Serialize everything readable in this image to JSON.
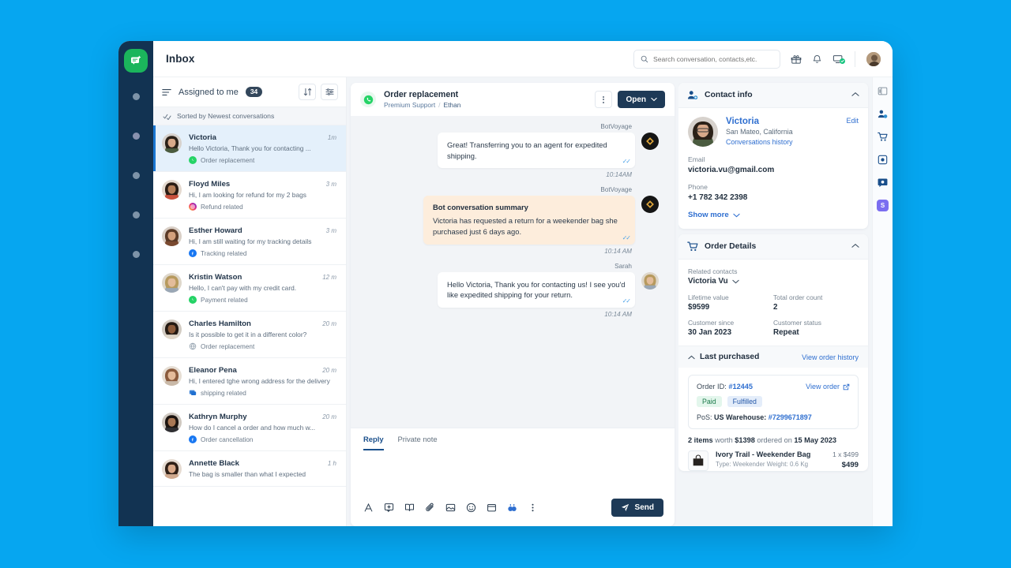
{
  "topbar": {
    "title": "Inbox",
    "search_placeholder": "Search conversation, contacts,etc.",
    "icons": [
      "gift-icon",
      "bell-icon",
      "screen-check-icon",
      "user-avatar"
    ]
  },
  "conversation_list": {
    "header_label": "Assigned to me",
    "header_count": "34",
    "sort_button": "sort-icon",
    "filter_button": "filter-icon",
    "sorted_label": "Sorted by Newest conversations",
    "items": [
      {
        "name": "Victoria",
        "time": "1m",
        "message": "Hello Victoria, Thank you for contacting ...",
        "tag": "Order replacement",
        "tag_channel": "whatsapp",
        "active": true
      },
      {
        "name": "Floyd Miles",
        "time": "3 m",
        "message": "Hi, I am looking for refund for my 2 bags",
        "tag": "Refund related",
        "tag_channel": "instagram",
        "active": false
      },
      {
        "name": "Esther Howard",
        "time": "3 m",
        "message": "Hi, I am still waiting for my tracking details",
        "tag": "Tracking related",
        "tag_channel": "facebook",
        "active": false
      },
      {
        "name": "Kristin Watson",
        "time": "12 m",
        "message": "Hello, I can't pay with my credit card.",
        "tag": "Payment related",
        "tag_channel": "whatsapp",
        "active": false
      },
      {
        "name": "Charles Hamilton",
        "time": "20 m",
        "message": "Is it possible to get it in a different color?",
        "tag": "Order replacement",
        "tag_channel": "web",
        "active": false
      },
      {
        "name": "Eleanor Pena",
        "time": "20 m",
        "message": "Hi, I entered tghe wrong address for the delivery",
        "tag": "shipping related",
        "tag_channel": "chat",
        "active": false
      },
      {
        "name": "Kathryn Murphy",
        "time": "20 m",
        "message": "How do I cancel a order and how much w...",
        "tag": "Order cancellation",
        "tag_channel": "facebook",
        "active": false
      },
      {
        "name": "Annette Black",
        "time": "1 h",
        "message": "The bag is smaller than what I expected",
        "tag": "",
        "tag_channel": "",
        "active": false
      }
    ]
  },
  "conversation": {
    "title": "Order replacement",
    "sub_team": "Premium Support",
    "sub_agent": "Ethan",
    "status_button": "Open",
    "messages": [
      {
        "sender": "BotVoyage",
        "title": "",
        "text": "Great! Transferring you to an agent for expedited shipping.",
        "time": "10:14AM",
        "style": "white",
        "avatar": "bot"
      },
      {
        "sender": "BotVoyage",
        "title": "Bot conversation summary",
        "text": "Victoria has requested a return for a weekender bag she purchased just 6 days ago.",
        "time": "10:14 AM",
        "style": "peach",
        "avatar": "bot"
      },
      {
        "sender": "Sarah",
        "title": "",
        "text": "Hello Victoria, Thank you for contacting us! I see you'd like expedited shipping for your return.",
        "time": "10:14 AM",
        "style": "white",
        "avatar": "agent"
      }
    ],
    "reply_tabs": [
      {
        "label": "Reply",
        "active": true
      },
      {
        "label": "Private note",
        "active": false
      }
    ],
    "toolbar_icons": [
      "text-format-icon",
      "canned-response-icon",
      "knowledge-base-icon",
      "attachment-icon",
      "image-icon",
      "emoji-icon",
      "calendar-icon",
      "ai-assist-icon",
      "more-options-icon"
    ],
    "send_label": "Send"
  },
  "contact_info": {
    "card_title": "Contact info",
    "name": "Victoria",
    "location": "San Mateo, California",
    "history_link": "Conversations history",
    "edit_link": "Edit",
    "email_label": "Email",
    "email": "victoria.vu@gmail.com",
    "phone_label": "Phone",
    "phone": "+1 782 342 2398",
    "show_more": "Show more"
  },
  "order_details": {
    "card_title": "Order Details",
    "related_contacts_label": "Related contacts",
    "related_contact": "Victoria Vu",
    "fields": [
      {
        "label": "Lifetime value",
        "value": "$9599"
      },
      {
        "label": "Total order count",
        "value": "2"
      },
      {
        "label": "Customer since",
        "value": "30 Jan 2023"
      },
      {
        "label": "Customer status",
        "value": "Repeat"
      }
    ],
    "last_purchased_title": "Last purchased",
    "view_order_history": "View order history",
    "order_id_label": "Order ID:",
    "order_id": "#12445",
    "view_order": "View order",
    "status_pills": [
      "Paid",
      "Fulfilled"
    ],
    "pos_label": "PoS:",
    "pos_warehouse": "US Warehouse:",
    "pos_number": "#7299671897",
    "items_summary_count": "2 items",
    "items_summary_worth": "worth",
    "items_summary_value": "$1398",
    "items_summary_ordered": "ordered on",
    "items_summary_date": "15 May 2023",
    "products": [
      {
        "name": "Ivory Trail - Weekender Bag",
        "meta": "Type: Weekender  Weight: 0.6 Kg",
        "qty": "1 x $499",
        "total": "$499"
      }
    ]
  },
  "icon_rail": {
    "items": [
      "panel-toggle-icon",
      "contact-icon",
      "cart-icon",
      "apps-icon",
      "settings-icon",
      "shopify-icon"
    ]
  },
  "left_rail": {
    "logo": "chat-logo",
    "items": [
      "nav-dot-1",
      "nav-dot-2",
      "nav-dot-3",
      "nav-dot-4",
      "nav-dot-5"
    ]
  },
  "colors": {
    "page_background": "#06a6f0",
    "rail_dark": "#123352",
    "accent_blue": "#2f6fd0",
    "button_dark": "#1e3a57",
    "logo_green": "#1bb55c"
  }
}
